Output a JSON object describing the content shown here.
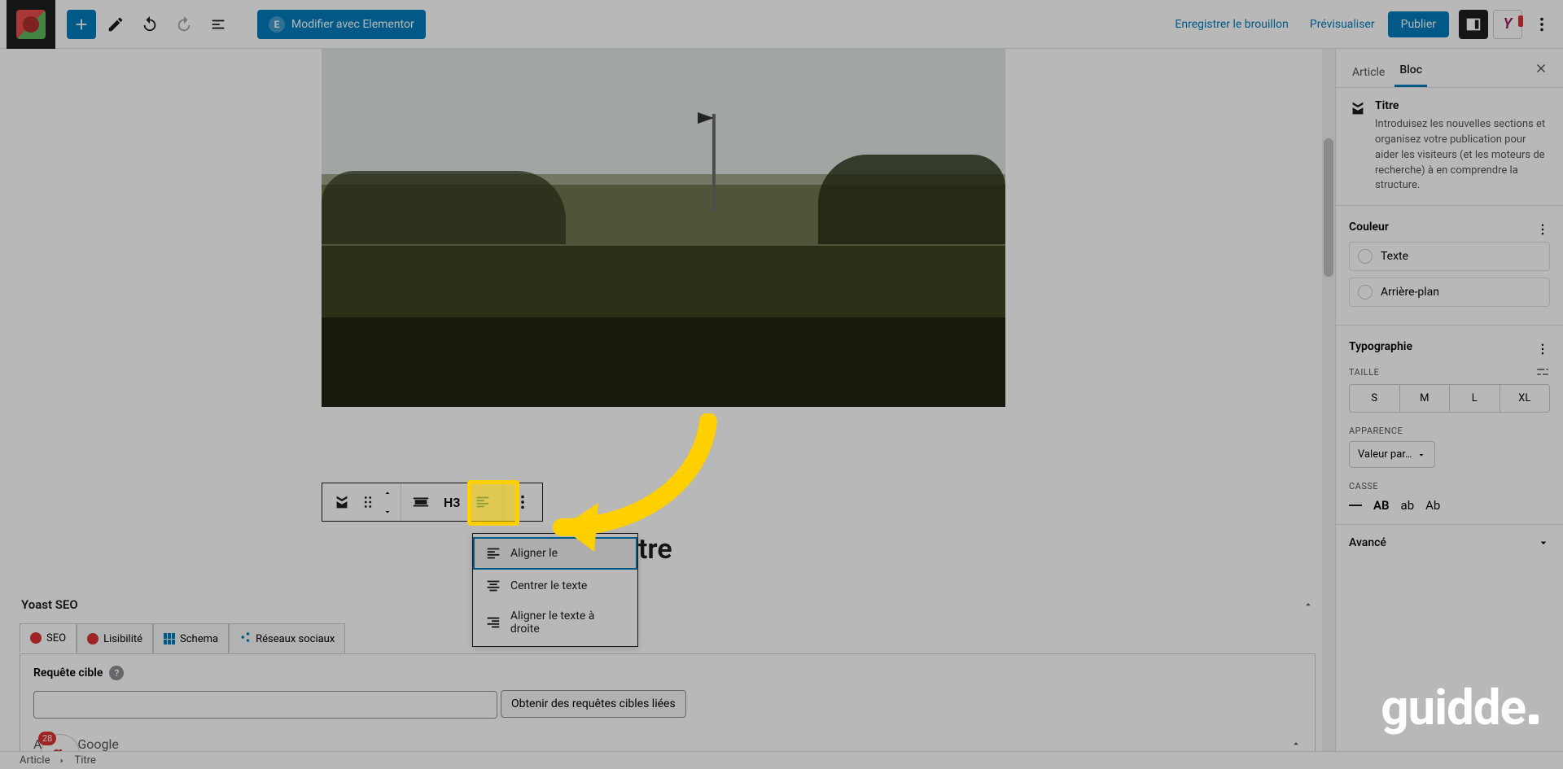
{
  "toolbar": {
    "elementor_label": "Modifier avec Elementor",
    "save_draft": "Enregistrer le brouillon",
    "preview": "Prévisualiser",
    "publish": "Publier"
  },
  "block_toolbar": {
    "heading_level": "H3"
  },
  "align_menu": {
    "left_full": "Aligner le texte à gauche",
    "left_visible": "Aligner le",
    "center": "Centrer le texte",
    "right": "Aligner le texte à droite"
  },
  "title_placeholder_suffix": "tre",
  "yoast": {
    "panel_title": "Yoast SEO",
    "tab_seo": "SEO",
    "tab_readability": "Lisibilité",
    "tab_schema": "Schema",
    "tab_social": "Réseaux sociaux",
    "focus_label": "Requête cible",
    "related_btn": "Obtenir des requêtes cibles liées",
    "google_preview": "Aperçu Google",
    "badge_count": "28"
  },
  "sidebar": {
    "tab_article": "Article",
    "tab_bloc": "Bloc",
    "block_name": "Titre",
    "block_desc": "Introduisez les nouvelles sections et organisez votre publication pour aider les visiteurs (et les moteurs de recherche) à en comprendre la structure.",
    "color_heading": "Couleur",
    "color_text": "Texte",
    "color_bg": "Arrière-plan",
    "typo_heading": "Typographie",
    "size_label": "TAILLE",
    "sizes": {
      "s": "S",
      "m": "M",
      "l": "L",
      "xl": "XL"
    },
    "appearance_label": "APPARENCE",
    "appearance_value": "Valeur par…",
    "casse_label": "CASSE",
    "casse_opts": {
      "ab_upper": "AB",
      "ab_lower": "ab",
      "ab_cap": "Ab"
    },
    "advanced": "Avancé"
  },
  "breadcrumb": {
    "root": "Article",
    "leaf": "Titre"
  },
  "watermark": "guidde"
}
